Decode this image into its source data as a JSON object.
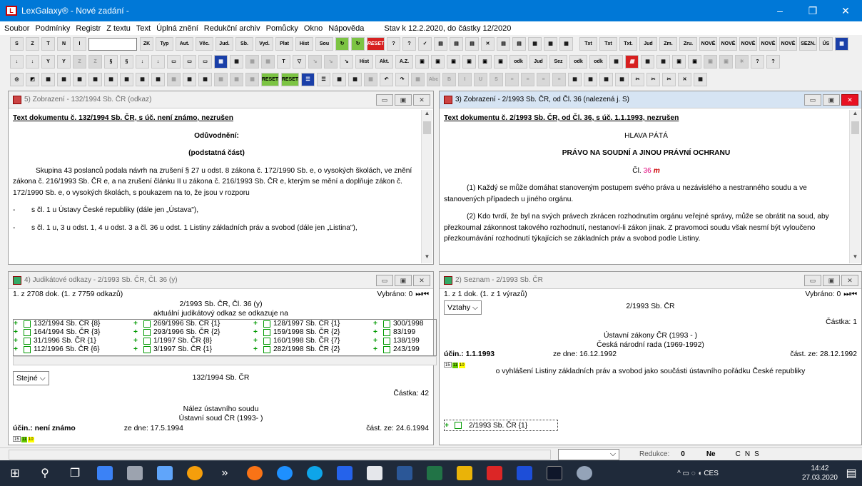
{
  "window": {
    "title": "LexGalaxy® - Nové zadání -",
    "min": "–",
    "max": "❐",
    "close": "✕"
  },
  "menu": {
    "items": [
      "Soubor",
      "Podmínky",
      "Registr",
      "Z textu",
      "Text",
      "Úplná znění",
      "Redukční archiv",
      "Pomůcky",
      "Okno",
      "Nápověda"
    ],
    "status": "Stav k 12.2.2020, do částky 12/2020"
  },
  "toolbar1": {
    "buttons": [
      "Typ",
      "Aut.",
      "Věc.",
      "Jud.",
      "Sb.",
      "Vyd.",
      "Plat",
      "Hist",
      "Sou",
      "RESET",
      "Txt",
      "Txt",
      "Txt.",
      "Jud",
      "Zm.",
      "Zru.",
      "NOVÉ",
      "NOVÉ",
      "NOVÉ",
      "NOVÉ",
      "NOVÉ",
      "SEZN.",
      "ÚS"
    ]
  },
  "toolbar2": {
    "buttons": [
      "Hist",
      "Akt.",
      "A.Z.",
      "odk",
      "Jud",
      "Sez",
      "odk",
      "odk",
      "RESET"
    ]
  },
  "panels": {
    "p5": {
      "title": "5) Zobrazení - 132/1994 Sb. ČR (odkaz)",
      "heading": "Text dokumentu č. 132/1994 Sb. ČR, s úč. není známo, nezrušen",
      "sub1": "Odůvodnění:",
      "sub2": "(podstatná část)",
      "para_a": "Skupina 43 poslanců podala návrh na zrušení § 27 ",
      "para_b": "u",
      " para_c": "",
      "p1": "Skupina 43 poslanců podala návrh na zrušení § 27 u odst. 8 zákona č. 172/1990 Sb. e, o vysokých školách, ve znění zákona č. 216/1993 Sb. ČR e, a na zrušení článku II u zákona č. 216/1993 Sb. ČR e, kterým se mění a doplňuje zákon č. 172/1990 Sb. e, o vysokých školách, s poukazem na to, že jsou v rozporu",
      "li1": "s čl. 1 u Ústavy České republiky (dále jen „Ústava\"),",
      "li2": "s čl. 1 u, 3 u odst. 1, 4 u odst. 3 a čl. 36 u odst. 1 Listiny základních práv a svobod (dále jen „Listina\"),"
    },
    "p3": {
      "title": "3) Zobrazení - 2/1993 Sb. ČR, od Čl. 36 (nalezená j. S)",
      "heading": "Text dokumentu č. 2/1993 Sb. ČR, od Čl. 36, s úč. 1.1.1993, nezrušen",
      "h1": "HLAVA PÁTÁ",
      "h2": "PRÁVO NA SOUDNÍ A JINOU PRÁVNÍ OCHRANU",
      "cl": "Čl.",
      "clnum": "36",
      "clm": "m",
      "p1": "(1) Každý se může domáhat stanoveným postupem svého práva u nezávislého a nestranného soudu a ve stanovených případech u jiného orgánu.",
      "p2": "(2) Kdo tvrdí, že byl na svých právech zkrácen rozhodnutím orgánu veřejné správy, může se obrátit na soud, aby přezkoumal zákonnost takového rozhodnutí, nestanoví-li zákon jinak. Z pravomoci soudu však nesmí být vyloučeno přezkoumávání rozhodnutí týkajících se základních práv a svobod podle Listiny."
    },
    "p4": {
      "title": "4) Judikátové odkazy - 2/1993 Sb. ČR, Čl. 36 (y)",
      "count": "1. z 2708 dok. (1. z 7759 odkazů)",
      "selected": "Vybráno: 0",
      "center1": "2/1993 Sb. ČR, Čl. 36 (y)",
      "center2": "aktuální judikátový odkaz se odkazuje na",
      "rows": [
        [
          "132/1994 Sb. ČR {8}",
          "269/1996 Sb. ČR {1}",
          "128/1997 Sb. ČR {1}",
          "300/1998"
        ],
        [
          "164/1994 Sb. ČR {3}",
          "293/1996 Sb. ČR {2}",
          "159/1998 Sb. ČR {2}",
          "83/199"
        ],
        [
          "31/1996 Sb. ČR {1}",
          "1/1997 Sb. ČR {8}",
          "160/1998 Sb. ČR {7}",
          "138/199"
        ],
        [
          "112/1996 Sb. ČR {6}",
          "3/1997 Sb. ČR {1}",
          "282/1998 Sb. ČR {2}",
          "243/199"
        ]
      ],
      "drop": "Stejné",
      "doc": "132/1994 Sb. ČR",
      "castka": "Částka: 42",
      "type": "Nález ústavního soudu",
      "court": "Ústavní soud ČR (1993-   )",
      "ucin": "účin.: není známo",
      "date": "ze dne: 17.5.1994",
      "cast": "část. ze: 24.6.1994",
      "badges": [
        "15",
        "11",
        "10"
      ]
    },
    "p2": {
      "title": "2) Seznam - 2/1993 Sb. ČR",
      "count": "1. z 1 dok. (1. z 1 výrazů)",
      "selected": "Vybráno: 0",
      "drop": "Vztahy",
      "doc": "2/1993 Sb. ČR",
      "castka": "Částka: 1",
      "l1": "Ústavní zákony ČR (1993 -   )",
      "l2": "Česká národní rada (1969-1992)",
      "ucin": "účin.: 1.1.1993",
      "date": "ze dne: 16.12.1992",
      "cast": "část. ze: 28.12.1992",
      "desc": "o vyhlášení Listiny základních práv a svobod jako součásti ústavního pořádku České republiky",
      "item": "2/1993 Sb. ČR {1}",
      "badges": [
        "15",
        "11",
        "10"
      ]
    }
  },
  "statusbar": {
    "reduction": "Redukce:",
    "redval": "0",
    "ne": "Ne",
    "flags": [
      "C",
      "N",
      "S"
    ]
  },
  "taskbar": {
    "time": "14:42",
    "date": "27.03.2020",
    "lang": "CES"
  }
}
